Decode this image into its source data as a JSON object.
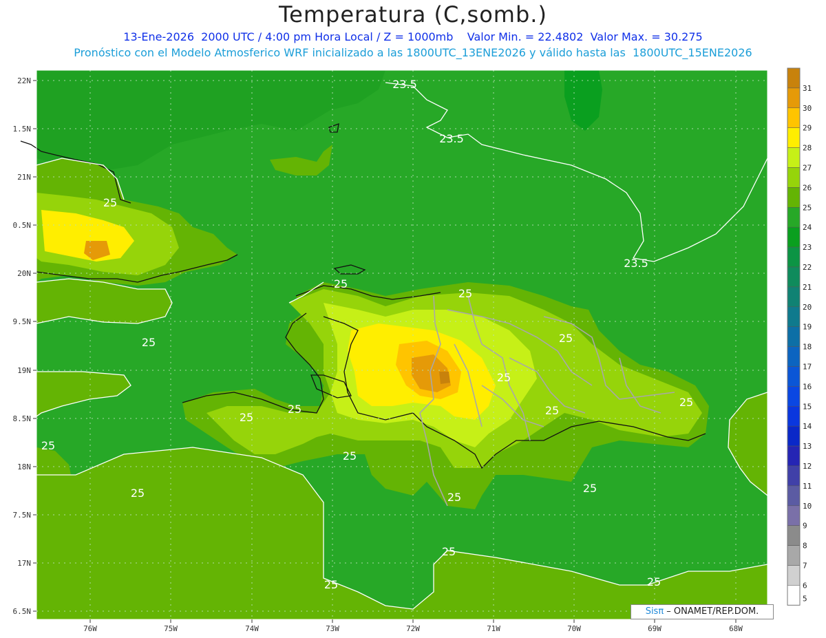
{
  "title": "Temperatura (C,somb.)",
  "subtitle_line1": "13-Ene-2026  2000 UTC / 4:00 pm Hora Local / Z = 1000mb    Valor Min. = 22.4802  Valor Max. = 30.275",
  "subtitle_line2": "Pronóstico con el Modelo Atmosferico WRF inicializado a las 1800UTC_13ENE2026 y válido hasta las  1800UTC_15ENE2026",
  "credit": {
    "brand": "Sisπ",
    "text": " – ONAMET/REP.DOM."
  },
  "x_ticks": [
    "76W",
    "75W",
    "74W",
    "73W",
    "72W",
    "71W",
    "70W",
    "69W",
    "68W"
  ],
  "y_ticks": [
    "22N",
    "1.5N",
    "21N",
    "0.5N",
    "20N",
    "9.5N",
    "19N",
    "8.5N",
    "18N",
    "7.5N",
    "17N",
    "6.5N"
  ],
  "colorbar": {
    "levels": [
      "31",
      "30",
      "29",
      "28",
      "27",
      "26",
      "25",
      "24",
      "23",
      "22",
      "21",
      "20",
      "19",
      "18",
      "17",
      "16",
      "15",
      "14",
      "13",
      "12",
      "11",
      "10",
      "9",
      "8",
      "7",
      "6",
      "5"
    ],
    "colors": [
      "#c8820c",
      "#e59a08",
      "#ffc400",
      "#ffee00",
      "#c6f017",
      "#96d40a",
      "#64b404",
      "#27a827",
      "#0a9f1f",
      "#0c9444",
      "#0f8b5c",
      "#108273",
      "#0f7a8d",
      "#0d6fa6",
      "#0c64c0",
      "#0b56d6",
      "#0a47e2",
      "#0a37de",
      "#0a28c8",
      "#2525b4",
      "#4040a8",
      "#5b5ba3",
      "#7a70a8",
      "#8b8b8b",
      "#a8a8a8",
      "#d0d0d0",
      "#ffffff"
    ]
  },
  "contour_labels": [
    "23.5",
    "23.5",
    "23.5",
    "25",
    "25",
    "25",
    "25",
    "25",
    "25",
    "25",
    "25",
    "25",
    "25",
    "25",
    "25",
    "25",
    "25",
    "25",
    "25",
    "25",
    "25"
  ],
  "colors": {
    "ocean": "#27a827",
    "land_low": "#64b404",
    "land_mid": "#96d40a",
    "land_high": "#ffee00",
    "land_peak": "#e59a08"
  }
}
